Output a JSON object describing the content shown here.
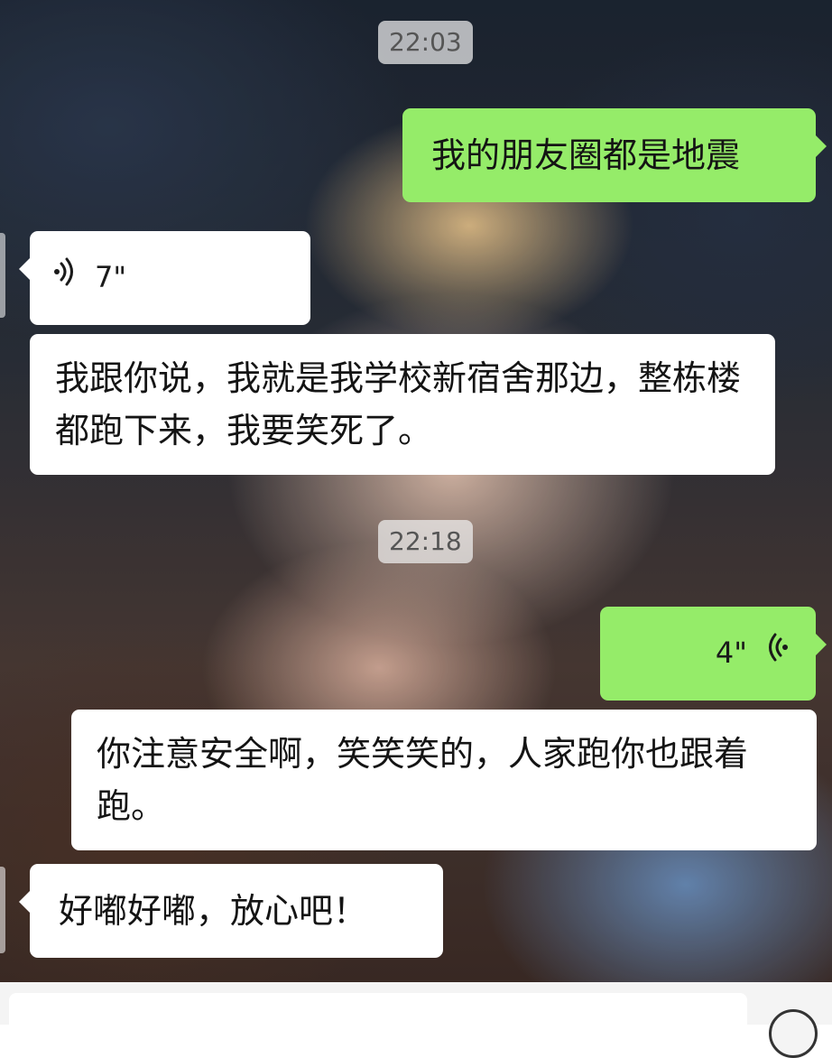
{
  "timestamps": [
    "22:03",
    "22:18"
  ],
  "messages": [
    {
      "type": "text",
      "side": "right",
      "text": "我的朋友圈都是地震"
    },
    {
      "type": "voice",
      "side": "left",
      "duration": "7\""
    },
    {
      "type": "text",
      "side": "left",
      "text": "我跟你说，我就是我学校新宿舍那边，整栋楼都跑下来，我要笑死了。"
    },
    {
      "type": "voice",
      "side": "right",
      "duration": "4\""
    },
    {
      "type": "text",
      "side": "left",
      "text": "你注意安全啊，笑笑笑的，人家跑你也跟着跑。"
    },
    {
      "type": "text",
      "side": "left",
      "text": "好嘟好嘟，放心吧！"
    }
  ],
  "colors": {
    "sent_bubble": "#95ec69",
    "received_bubble": "#ffffff",
    "timestamp_bg": "#f0f0f0"
  }
}
